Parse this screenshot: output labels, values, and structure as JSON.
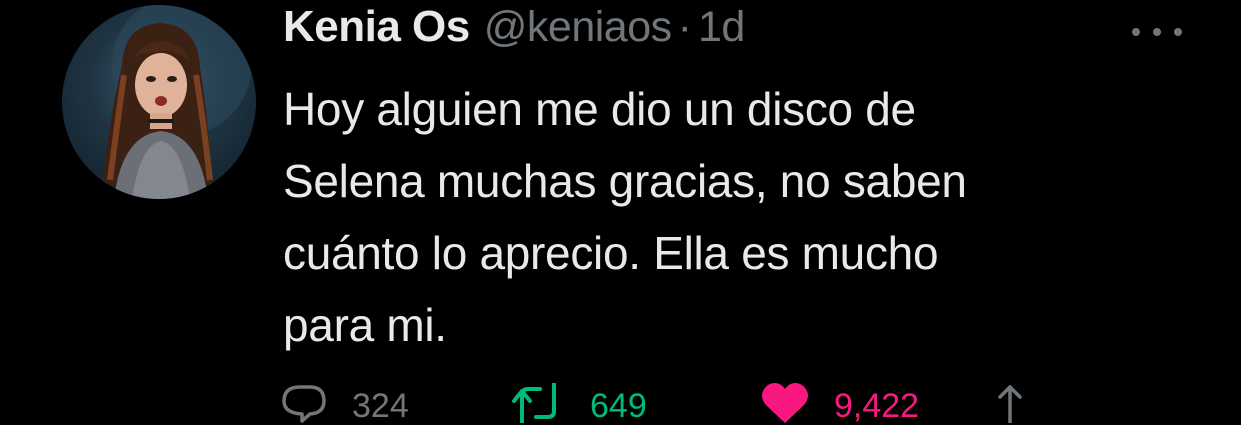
{
  "tweet": {
    "display_name": "Kenia Os",
    "handle": "@keniaos",
    "separator": "·",
    "time": "1d",
    "text": "Hoy alguien me dio un disco de\nSelena muchas gracias, no saben\ncuánto lo aprecio. Ella es mucho\npara mi.",
    "more_icon": "ellipsis-icon"
  },
  "actions": {
    "reply": {
      "icon": "reply-icon",
      "count": "324"
    },
    "retweet": {
      "icon": "retweet-icon",
      "count": "649"
    },
    "like": {
      "icon": "heart-icon",
      "count": "9,422"
    },
    "share": {
      "icon": "share-icon",
      "count": ""
    }
  },
  "colors": {
    "background": "#000000",
    "primary_text": "#e7e9ea",
    "secondary_text": "#71767b",
    "retweet_green": "#00ba7c",
    "like_pink": "#f91880"
  }
}
